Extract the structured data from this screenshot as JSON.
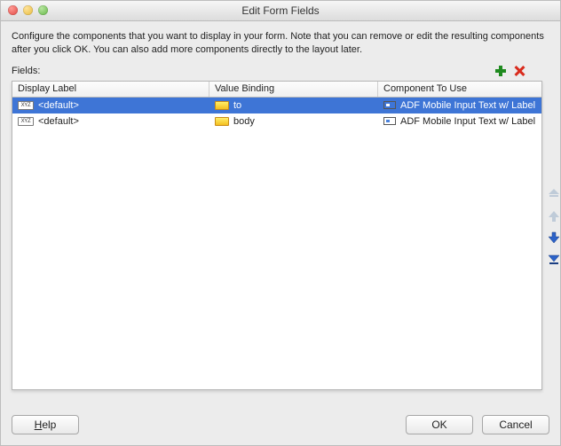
{
  "window": {
    "title": "Edit Form Fields"
  },
  "description": "Configure the components that you want to display in your form.  Note that you can remove or edit the resulting components after you click OK.  You can also add more components directly to the layout later.",
  "fields_label": "Fields:",
  "table": {
    "headers": {
      "c1": "Display Label",
      "c2": "Value Binding",
      "c3": "Component To Use"
    },
    "rows": [
      {
        "selected": true,
        "c1_icon": "xyz",
        "c1": "<default>",
        "c2_icon": "chip",
        "c2": "to",
        "c3_icon": "component",
        "c3": "ADF Mobile Input Text w/ Label"
      },
      {
        "selected": false,
        "c1_icon": "xyz",
        "c1": "<default>",
        "c2_icon": "chip",
        "c2": "body",
        "c3_icon": "component",
        "c3": "ADF Mobile Input Text w/ Label"
      }
    ]
  },
  "buttons": {
    "help": "Help",
    "ok": "OK",
    "cancel": "Cancel"
  },
  "side": {
    "move_top": "move-top",
    "move_up": "move-up",
    "move_down": "move-down",
    "move_bottom": "move-bottom"
  }
}
